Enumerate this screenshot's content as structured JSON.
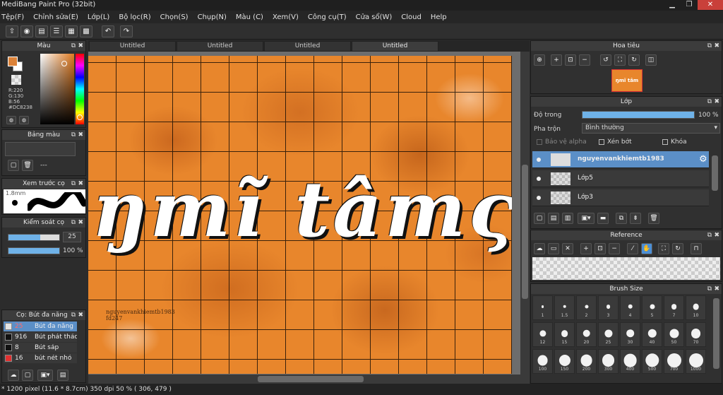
{
  "window": {
    "title": "MediBang Paint Pro (32bit)",
    "minimize": "▁",
    "maximize": "❐",
    "close": "✕"
  },
  "menu": [
    "Tệp(F)",
    "Chỉnh sửa(E)",
    "Lớp(L)",
    "Bộ lọc(R)",
    "Chọn(S)",
    "Chụp(N)",
    "Màu (C)",
    "Xem(V)",
    "Công cụ(T)",
    "Cửa sổ(W)",
    "Cloud",
    "Help"
  ],
  "tabs": [
    "Untitled",
    "Untitled",
    "Untitled",
    "Untitled"
  ],
  "color_panel": {
    "title": "Màu",
    "r": "R:220",
    "g": "G:130",
    "b": "B:56",
    "hex": "#DC8238",
    "fg": "#DC8238"
  },
  "palette_panel": {
    "title": "Bảng màu",
    "value": "---"
  },
  "preview_panel": {
    "title": "Xem trước cọ",
    "size": "1.8mm"
  },
  "brush_control": {
    "title": "Kiểm soát cọ",
    "size": "25",
    "size_fraction": 0.62,
    "opacity": "100 %",
    "opacity_fraction": 1.0
  },
  "brush_list": {
    "title": "Cọ: Bút đa năng",
    "items": [
      {
        "size": "25",
        "name": "Bút đa năng",
        "color": "#e4e4e4",
        "selected": true
      },
      {
        "size": "916",
        "name": "Bút phát thảo",
        "color": "#111111",
        "selected": false
      },
      {
        "size": "8",
        "name": "Bút sáp",
        "color": "#111111",
        "selected": false
      },
      {
        "size": "16",
        "name": "bút nét nhỏ",
        "color": "#e23030",
        "selected": false
      }
    ]
  },
  "canvas": {
    "art_text": "ŋmĩ tâmς",
    "signature_line1": "nguyenvankhiemtb1983",
    "signature_line2": "fd247"
  },
  "navigator": {
    "title": "Hoa tiêu",
    "thumb_text": "ŋmĩ tâm"
  },
  "layer_panel": {
    "title": "Lớp",
    "opacity_label": "Độ trong",
    "opacity_value": "100 %",
    "opacity_fraction": 1.0,
    "blend_label": "Pha trộn",
    "blend_value": "Bình thường",
    "protect_alpha": "Bảo vệ alpha",
    "clipping": "Xén bớt",
    "lock": "Khóa",
    "layers": [
      {
        "name": "nguyenvankhiemtb1983",
        "selected": true
      },
      {
        "name": "Lớp5",
        "selected": false
      },
      {
        "name": "Lớp3",
        "selected": false
      }
    ]
  },
  "reference_panel": {
    "title": "Reference"
  },
  "brush_size_panel": {
    "title": "Brush Size",
    "sizes": [
      "1",
      "1.5",
      "2",
      "3",
      "4",
      "5",
      "7",
      "10",
      "12",
      "15",
      "20",
      "25",
      "30",
      "40",
      "50",
      "70",
      "100",
      "150",
      "200",
      "300",
      "400",
      "500",
      "700",
      "1000"
    ]
  },
  "status": {
    "text": "* 1200 pixel  (11.6 * 8.7cm)  350 dpi  50 %  ( 306, 479 )"
  }
}
